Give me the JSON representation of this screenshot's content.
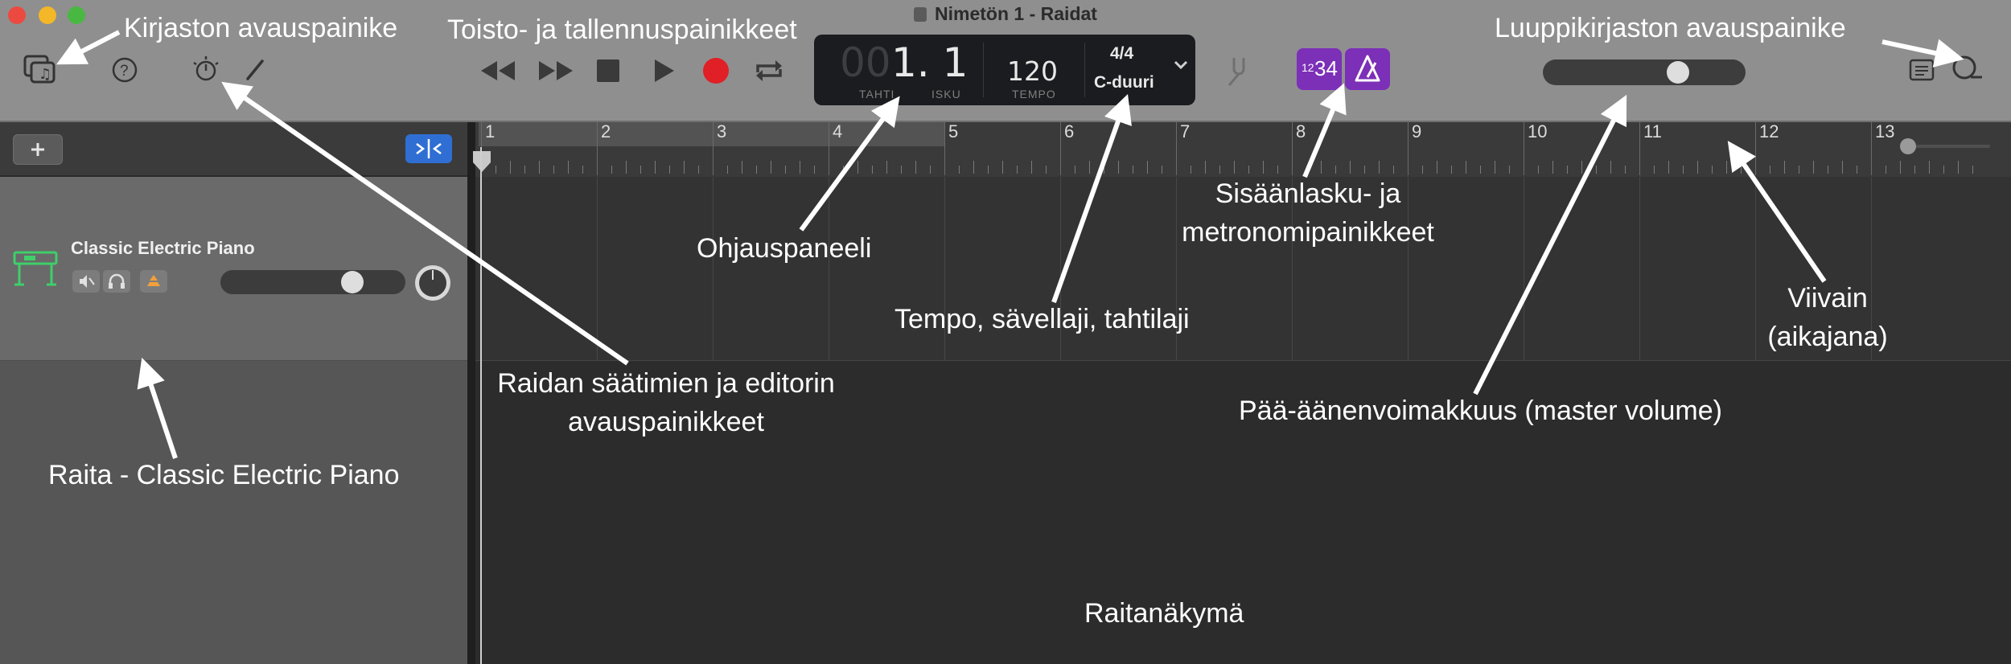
{
  "window": {
    "title": "Nimetön 1 - Raidat"
  },
  "lcd": {
    "bar_dim": "00",
    "position": "1. 1",
    "bar_label": "TAHTI",
    "beat_label": "ISKU",
    "tempo": "120",
    "tempo_label": "TEMPO",
    "time_signature": "4/4",
    "key": "C-duuri"
  },
  "count_in": {
    "small": "12",
    "big": "34"
  },
  "ruler": {
    "bars": [
      "1",
      "2",
      "3",
      "4",
      "5",
      "6",
      "7",
      "8",
      "9",
      "10",
      "11",
      "12",
      "13"
    ]
  },
  "track": {
    "name": "Classic Electric Piano"
  },
  "annotations": {
    "library": "Kirjaston avauspainike",
    "transport": "Toisto- ja tallennuspainikkeet",
    "loop_library": "Luuppikirjaston avauspainike",
    "control_bar": "Ohjauspaneeli",
    "count_in_1": "Sisäänlasku- ja",
    "count_in_2": "metronomipainikkeet",
    "tempo_key": "Tempo, sävellaji, tahtilaji",
    "ruler_1": "Viivain",
    "ruler_2": "(aikajana)",
    "smart_controls_1": "Raidan säätimien ja editorin",
    "smart_controls_2": "avauspainikkeet",
    "master_volume": "Pää-äänenvoimakkuus (master volume)",
    "track": "Raita - Classic Electric Piano",
    "tracks_area": "Raitanäkymä"
  },
  "colors": {
    "record": "#e01f26",
    "purple": "#7c2fb7",
    "blue_button": "#2f6fd3",
    "instrument_green": "#3fcf6a"
  }
}
